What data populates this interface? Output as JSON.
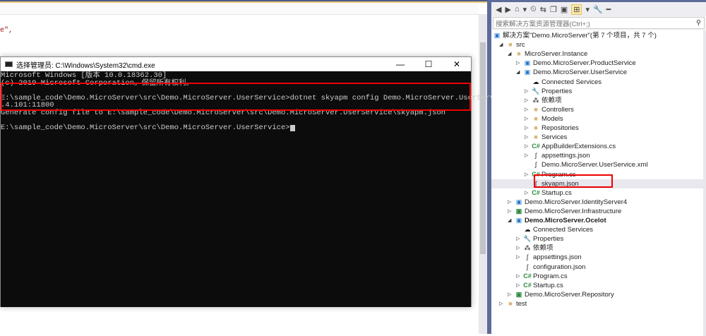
{
  "editor": {
    "code_fragment": "e\","
  },
  "cmd": {
    "title": "选择管理员: C:\\Windows\\System32\\cmd.exe",
    "minimize": "—",
    "maximize": "☐",
    "close": "✕",
    "lines": [
      "Microsoft Windows [版本 10.0.18362.30]",
      "(c) 2019 Microsoft Corporation。保留所有权利。",
      "",
      "E:\\sample_code\\Demo.MicroServer\\src\\Demo.MicroServer.UserService>dotnet skyapm config Demo.MicroServer.UserService ▇▇",
      ".4.101:11800",
      "Generate config file to E:\\sample_code\\Demo.MicroServer\\src\\Demo.MicroServer.UserService\\skyapm.json",
      "",
      "E:\\sample_code\\Demo.MicroServer\\src\\Demo.MicroServer.UserService>"
    ]
  },
  "solution_explorer": {
    "toolbar": [
      "◀",
      "▶",
      "⌂",
      "▾",
      "⏲",
      "⇆",
      "❐",
      "▣",
      "⊞",
      "▾",
      "🔧",
      "━"
    ],
    "search_placeholder": "搜索解决方案资源管理器(Ctrl+;)",
    "search_icon": "⚲",
    "tree": [
      {
        "label": "解决方案\"Demo.MicroServer\"(第 7 个项目，共 7 个)",
        "level": 0,
        "arrow": "",
        "icon": "solution-icon"
      },
      {
        "label": "src",
        "level": 1,
        "arrow": "◢",
        "icon": "folder-icon"
      },
      {
        "label": "MicroServer.Instance",
        "level": 2,
        "arrow": "◢",
        "icon": "folder-icon"
      },
      {
        "label": "Demo.MicroServer.ProductService",
        "level": 3,
        "arrow": "▷",
        "icon": "web-project-icon"
      },
      {
        "label": "Demo.MicroServer.UserService",
        "level": 3,
        "arrow": "◢",
        "icon": "web-project-icon"
      },
      {
        "label": "Connected Services",
        "level": 4,
        "arrow": "",
        "icon": "cloud-icon"
      },
      {
        "label": "Properties",
        "level": 4,
        "arrow": "▷",
        "icon": "wrench-icon"
      },
      {
        "label": "依赖项",
        "level": 4,
        "arrow": "▷",
        "icon": "dependencies-icon"
      },
      {
        "label": "Controllers",
        "level": 4,
        "arrow": "▷",
        "icon": "folder-icon"
      },
      {
        "label": "Models",
        "level": 4,
        "arrow": "▷",
        "icon": "folder-icon"
      },
      {
        "label": "Repositories",
        "level": 4,
        "arrow": "▷",
        "icon": "folder-icon"
      },
      {
        "label": "Services",
        "level": 4,
        "arrow": "▷",
        "icon": "folder-icon"
      },
      {
        "label": "AppBuilderExtensions.cs",
        "level": 4,
        "arrow": "▷",
        "icon": "csharp-icon"
      },
      {
        "label": "appsettings.json",
        "level": 4,
        "arrow": "▷",
        "icon": "json-icon"
      },
      {
        "label": "Demo.MicroServer.UserService.xml",
        "level": 4,
        "arrow": "",
        "icon": "xml-icon"
      },
      {
        "label": "Program.cs",
        "level": 4,
        "arrow": "▷",
        "icon": "csharp-icon"
      },
      {
        "label": "skyapm.json",
        "level": 4,
        "arrow": "",
        "icon": "json-icon",
        "selected": true
      },
      {
        "label": "Startup.cs",
        "level": 4,
        "arrow": "▷",
        "icon": "csharp-icon"
      },
      {
        "label": "Demo.MicroServer.IdentityServer4",
        "level": 2,
        "arrow": "▷",
        "icon": "web-project-icon"
      },
      {
        "label": "Demo.MicroServer.Infrastructure",
        "level": 2,
        "arrow": "▷",
        "icon": "csharp-project-icon"
      },
      {
        "label": "Demo.MicroServer.Ocelot",
        "level": 2,
        "arrow": "◢",
        "icon": "web-project-icon",
        "bold": true
      },
      {
        "label": "Connected Services",
        "level": 3,
        "arrow": "",
        "icon": "cloud-icon"
      },
      {
        "label": "Properties",
        "level": 3,
        "arrow": "▷",
        "icon": "wrench-icon"
      },
      {
        "label": "依赖项",
        "level": 3,
        "arrow": "▷",
        "icon": "dependencies-icon"
      },
      {
        "label": "appsettings.json",
        "level": 3,
        "arrow": "▷",
        "icon": "json-icon"
      },
      {
        "label": "configuration.json",
        "level": 3,
        "arrow": "",
        "icon": "json-icon"
      },
      {
        "label": "Program.cs",
        "level": 3,
        "arrow": "▷",
        "icon": "csharp-icon"
      },
      {
        "label": "Startup.cs",
        "level": 3,
        "arrow": "▷",
        "icon": "csharp-icon"
      },
      {
        "label": "Demo.MicroServer.Repository",
        "level": 2,
        "arrow": "▷",
        "icon": "csharp-project-icon"
      },
      {
        "label": "test",
        "level": 1,
        "arrow": "▷",
        "icon": "folder-icon"
      }
    ]
  },
  "colors": {
    "highlight": "#ee0000",
    "console_bg": "#0c0c0c",
    "vs_frame": "#5d6b99"
  }
}
